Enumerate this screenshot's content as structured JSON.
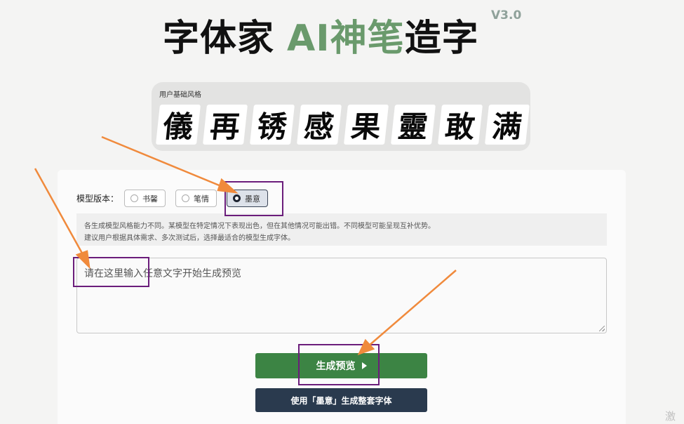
{
  "header": {
    "title_black": "字体家",
    "title_green": "AI神笔",
    "title_black2": "造字",
    "version": "V3.0"
  },
  "style_panel": {
    "label": "用户基础风格",
    "glyphs": [
      "儀",
      "再",
      "锈",
      "感",
      "果",
      "靈",
      "敢",
      "满"
    ]
  },
  "model_selector": {
    "label": "模型版本：",
    "options": [
      {
        "label": "书馨",
        "selected": false
      },
      {
        "label": "笔情",
        "selected": false
      },
      {
        "label": "墨意",
        "selected": true
      }
    ]
  },
  "info": {
    "line1": "各生成模型风格能力不同。某模型在特定情况下表现出色，但在其他情况可能出错。不同模型可能呈现互补优势。",
    "line2": "建议用户根据具体需求、多次测试后，选择最适合的模型生成字体。"
  },
  "input": {
    "placeholder": "请在这里输入任意文字开始生成预览"
  },
  "buttons": {
    "preview": "生成预览",
    "generate_full": "使用「墨意」生成整套字体"
  },
  "watermark": "激活",
  "colors": {
    "accent_green": "#3c8444",
    "title_green": "#6a9a6c",
    "dark_button": "#2a3a4e",
    "highlight_purple": "#6b1d7b",
    "arrow_orange": "#f08a3c"
  }
}
